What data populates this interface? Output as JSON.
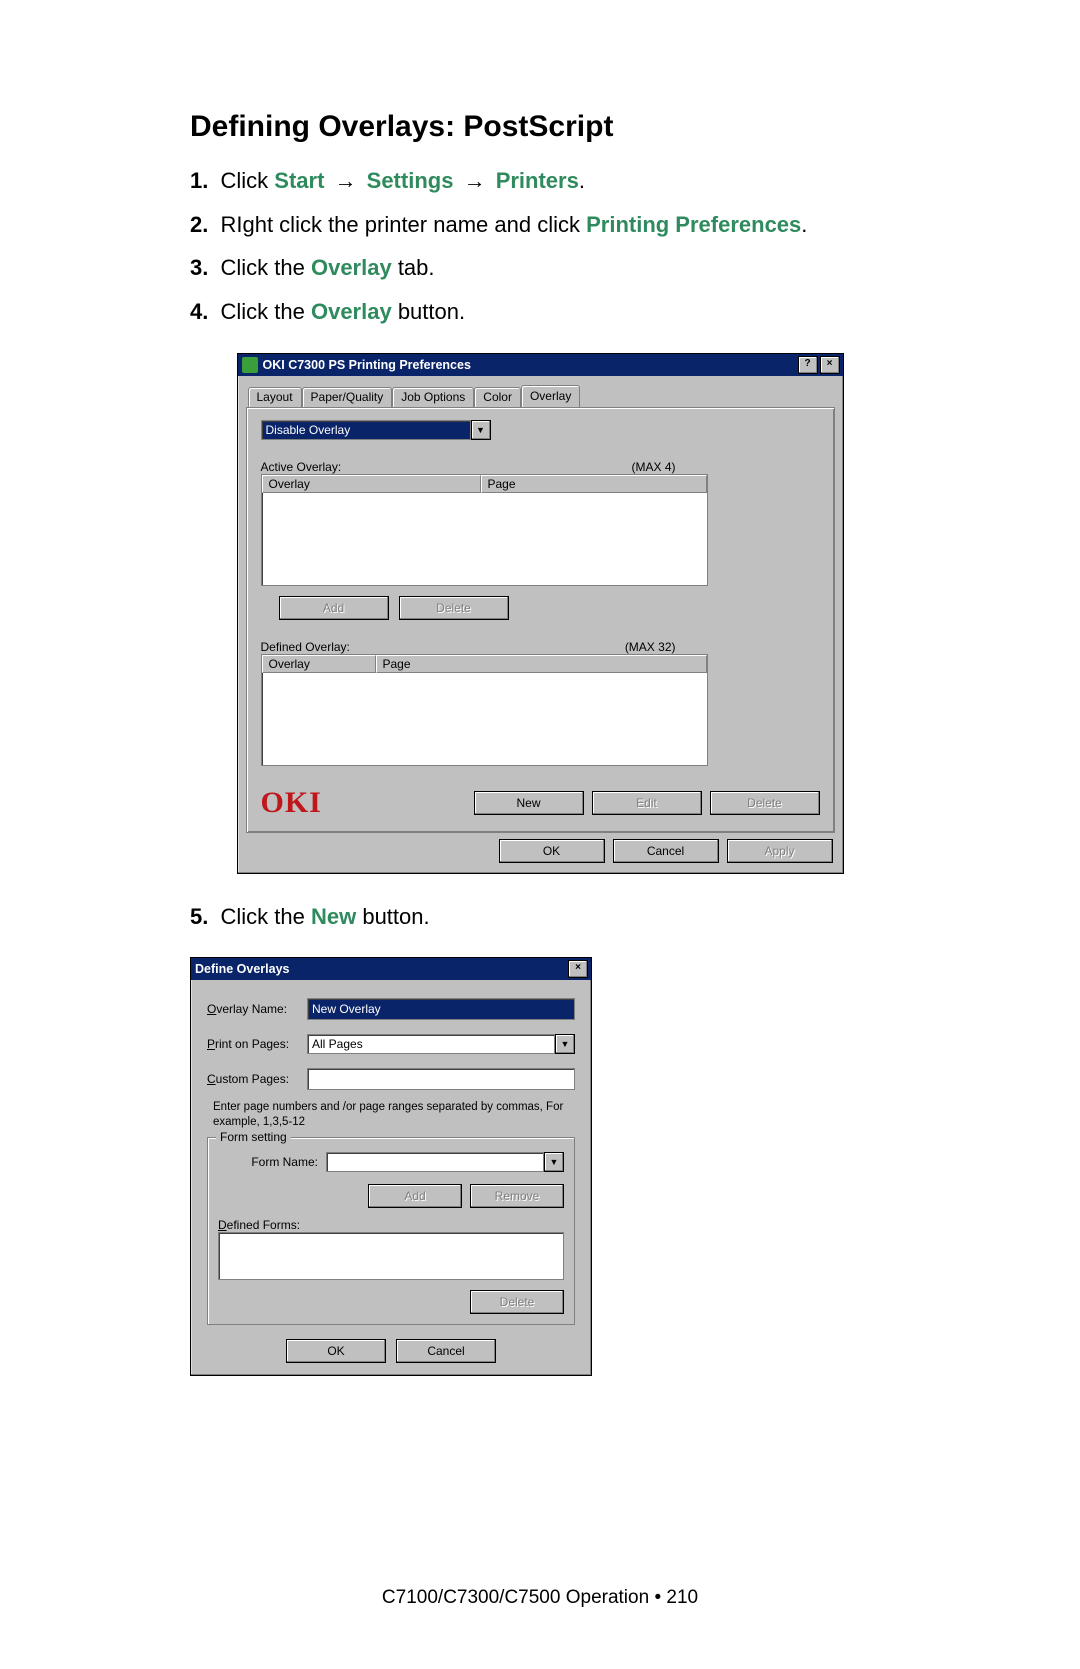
{
  "heading": "Defining Overlays: PostScript",
  "steps": {
    "s1": {
      "num": "1.",
      "pre": "Click ",
      "a": "Start",
      "b": "Settings",
      "c": "Printers",
      "post": "."
    },
    "s2": {
      "num": "2.",
      "pre": "RIght click the printer name and click ",
      "a": "Printing Preferences",
      "post": "."
    },
    "s3": {
      "num": "3.",
      "pre": "Click the ",
      "a": "Overlay",
      "post": " tab."
    },
    "s4": {
      "num": "4.",
      "pre": "Click the ",
      "a": "Overlay",
      "post": " button."
    },
    "s5": {
      "num": "5.",
      "pre": "Click the ",
      "a": "New",
      "post": " button."
    }
  },
  "arrow": "→",
  "dlg1": {
    "title": "OKI C7300 PS Printing Preferences",
    "help_btn": "?",
    "close_btn": "×",
    "tabs": {
      "layout": "Layout",
      "paper": "Paper/Quality",
      "job": "Job Options",
      "color": "Color",
      "overlay": "Overlay"
    },
    "disable_overlay": "Disable Overlay",
    "active_label": "Active Overlay:",
    "active_max": "(MAX 4)",
    "col_overlay": "Overlay",
    "col_page": "Page",
    "btn_add": "Add",
    "btn_delete": "Delete",
    "defined_label": "Defined Overlay:",
    "defined_max": "(MAX 32)",
    "brand": "OKI",
    "btn_new": "New",
    "btn_edit": "Edit",
    "btn_delete2": "Delete",
    "btn_ok": "OK",
    "btn_cancel": "Cancel",
    "btn_apply": "Apply"
  },
  "dlg2": {
    "title": "Define Overlays",
    "close_btn": "×",
    "lbl_name": "Overlay Name:",
    "val_name": "New Overlay",
    "lbl_print": "Print on Pages:",
    "val_print": "All Pages",
    "lbl_custom": "Custom Pages:",
    "hint": "Enter page numbers and /or page ranges separated by commas, For example, 1,3,5-12",
    "grp": "Form setting",
    "lbl_form": "Form Name:",
    "btn_add": "Add",
    "btn_remove": "Remove",
    "lbl_defforms": "Defined Forms:",
    "btn_delete": "Delete",
    "btn_ok": "OK",
    "btn_cancel": "Cancel"
  },
  "footer": "C7100/C7300/C7500  Operation • 210"
}
